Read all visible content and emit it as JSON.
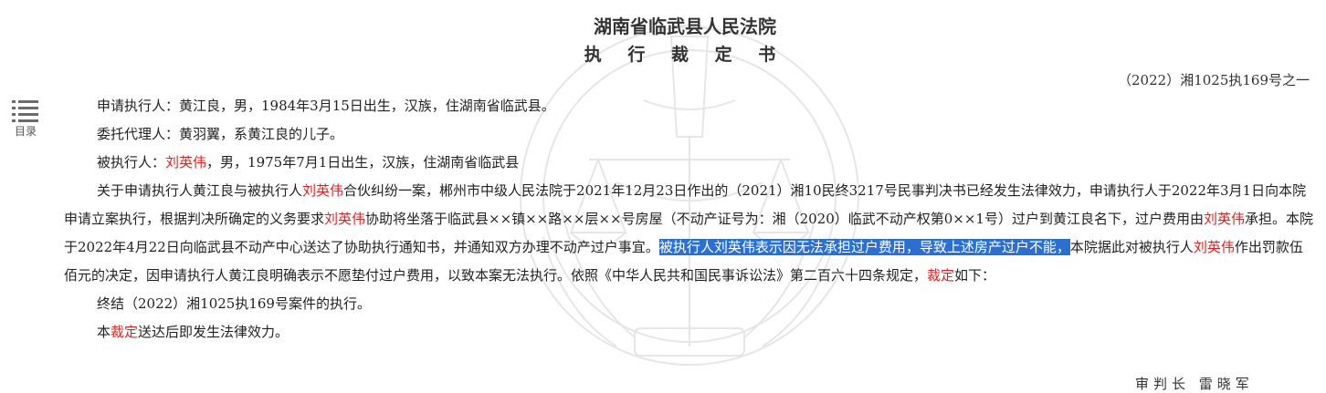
{
  "toc": {
    "label": "目录",
    "icon": "list-icon"
  },
  "header": {
    "court": "湖南省临武县人民法院",
    "title": "执 行 裁 定 书",
    "case_no": "（2022）湘1025执169号之一"
  },
  "parties": {
    "applicant": "申请执行人：黄江良，男，1984年3月15日出生，汉族，住湖南省临武县。",
    "agent": "委托代理人：黄羽翼，系黄江良的儿子。",
    "respondent_prefix": "被执行人：",
    "respondent_name": "刘英伟",
    "respondent_suffix": "，男，1975年7月1日出生，汉族，住湖南省临武县"
  },
  "facts": {
    "t1": "关于申请执行人黄江良与被执行人",
    "n1": "刘英伟",
    "t2": "合伙纠纷一案，郴州市中级人民法院于2021年12月23日作出的（2021）湘10民终3217号民事判决书已经发生法律效力，申请执行人于2022年3月1日向本院申请立案执行，根据判决所确定的义务要求",
    "n2": "刘英伟",
    "t3": "协助将坐落于临武县××镇××路××层××号房屋（不动产证号为：湘（2020）临武不动产权第0××1号）过户到黄江良名下，过户费用由",
    "n3": "刘英伟",
    "t4": "承担。本院于2022年4月22日向临武县不动产中心送达了协助执行通知书，并通知双方办理不动产过户事宜。",
    "highlight": "被执行人刘英伟表示因无法承担过户费用，导致上述房产过户不能，",
    "t5": "本院据此对被执行人",
    "n4": "刘英伟",
    "t6": "作出罚款伍佰元的决定，因申请执行人黄江良明确表示不愿垫付过户费用，以致本案无法执行。依照《中华人民共和国民事诉讼法》第二百六十四条规定，",
    "ruling": "裁定",
    "t7": "如下："
  },
  "decision": "终结（2022）湘1025执169号案件的执行。",
  "effect": {
    "prefix": "本",
    "ruling": "裁定",
    "suffix": "送达后即发生法律效力。"
  },
  "signature": "审判长 雷晓军",
  "colors": {
    "name_red": "#e02020",
    "selection_blue": "#2c6fd0",
    "text": "#222222"
  }
}
